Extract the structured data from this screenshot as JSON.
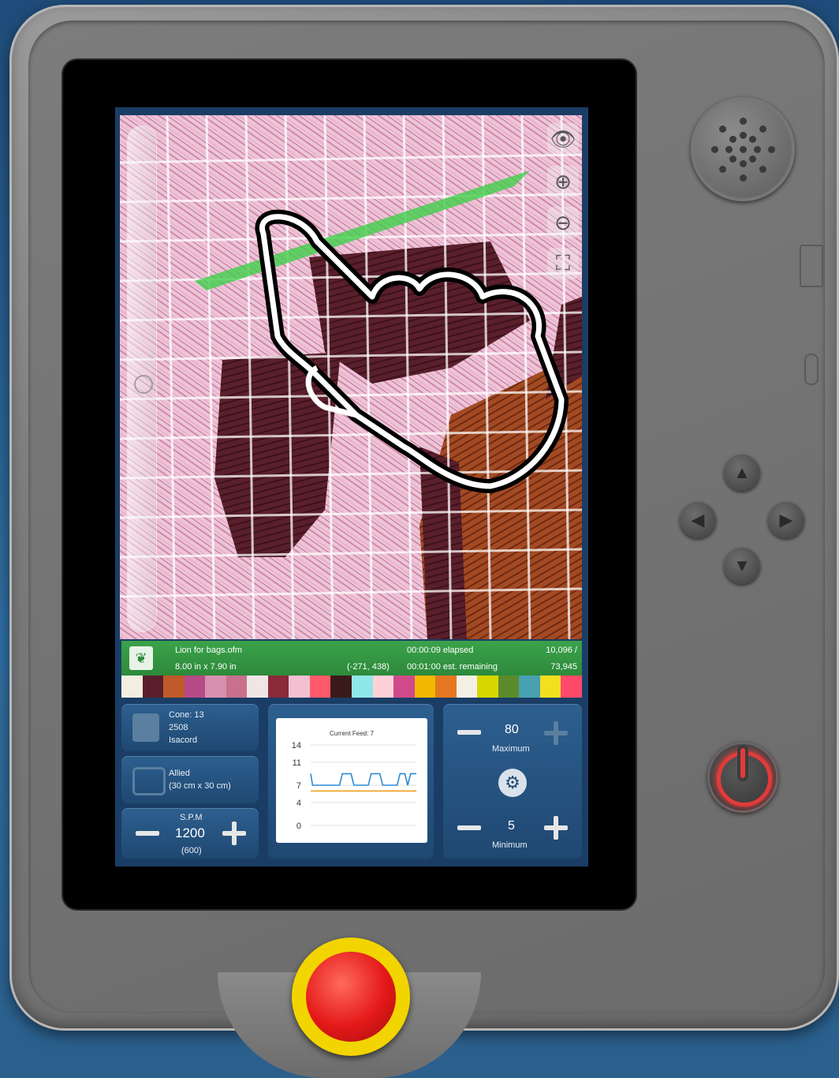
{
  "design": {
    "file_name": "Lion for bags.ofm",
    "size": "8.00 in x 7.90 in",
    "coordinates": "(-271, 438)",
    "elapsed": "00:00:09 elapsed",
    "remaining": "00:01:00 est. remaining",
    "stitch_current": "10,096 /",
    "stitch_total": "73,945"
  },
  "thread": {
    "line1": "Cone: 13",
    "line2": "2508",
    "line3": "Isacord"
  },
  "hoop": {
    "line1": "Allied",
    "line2": "(30 cm x 30 cm)"
  },
  "spm": {
    "label": "S.P.M",
    "value": "1200",
    "sub": "(600)"
  },
  "feed": {
    "maximum_value": "80",
    "maximum_label": "Maximum",
    "minimum_value": "5",
    "minimum_label": "Minimum"
  },
  "swatch_colors": [
    "#f2eee0",
    "#5b1f2b",
    "#c05a2a",
    "#b64b87",
    "#d88fb0",
    "#c9708e",
    "#f0e6e6",
    "#8a2a3a",
    "#f2c0d0",
    "#ff5a6a",
    "#3a1a1a",
    "#8fe8e8",
    "#ffd0d8",
    "#d04a8a",
    "#f0b800",
    "#e47820",
    "#f5f0e6",
    "#d6d600",
    "#5a8a2a",
    "#48a0b0",
    "#f2e020",
    "#ff4a6a"
  ],
  "chart_data": {
    "type": "line",
    "title": "Current Feed: 7",
    "ylim": [
      0,
      14
    ],
    "yticks": [
      0,
      4,
      7,
      11,
      14
    ],
    "series": [
      {
        "color": "#2a8bd6",
        "x": [
          0,
          2,
          4,
          30,
          33,
          42,
          45,
          60,
          63,
          72,
          75,
          90,
          93,
          98,
          101,
          104,
          107,
          110
        ],
        "values": [
          9,
          7,
          7,
          7,
          9,
          9,
          7,
          7,
          9,
          9,
          7,
          7,
          9,
          9,
          7,
          9,
          9,
          9
        ]
      },
      {
        "color": "#f0a020",
        "x": [
          0,
          110
        ],
        "values": [
          6,
          6
        ]
      }
    ]
  }
}
